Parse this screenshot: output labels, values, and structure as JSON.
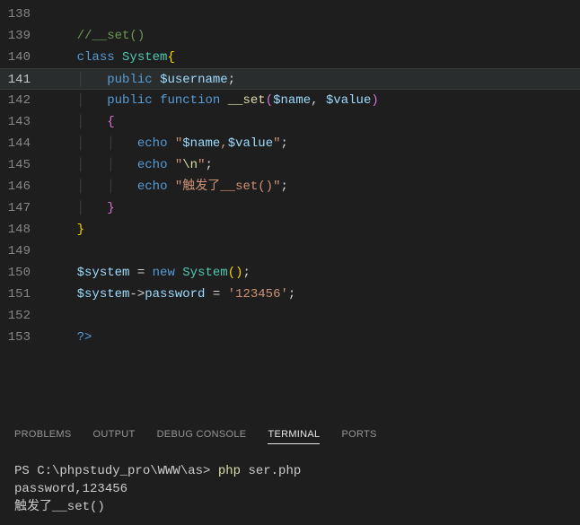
{
  "editor": {
    "lines": [
      {
        "num": "138",
        "html": ""
      },
      {
        "num": "139",
        "html": "<span class='c-comment'>//__set()</span>"
      },
      {
        "num": "140",
        "html": "<span class='c-keyword'>class</span> <span class='c-type'>System</span><span class='c-paren'>{</span>"
      },
      {
        "num": "141",
        "active": true,
        "html": "<span class='indent-guide'>│</span>   <span class='c-keyword'>public</span> <span class='c-var'>$username</span><span class='c-punct'>;</span>"
      },
      {
        "num": "142",
        "html": "<span class='indent-guide'>│</span>   <span class='c-keyword'>public</span> <span class='c-keyword'>function</span> <span class='c-func'>__set</span><span class='c-paren-pink'>(</span><span class='c-var'>$name</span><span class='c-punct'>,</span> <span class='c-var'>$value</span><span class='c-paren-pink'>)</span>"
      },
      {
        "num": "143",
        "html": "<span class='indent-guide'>│</span>   <span class='c-paren-pink'>{</span>"
      },
      {
        "num": "144",
        "html": "<span class='indent-guide'>│</span>   <span class='indent-guide'>│</span>   <span class='c-keyword'>echo</span> <span class='c-string'>\"</span><span class='c-var'>$name</span><span class='c-string'>,</span><span class='c-var'>$value</span><span class='c-string'>\"</span><span class='c-punct'>;</span>"
      },
      {
        "num": "145",
        "html": "<span class='indent-guide'>│</span>   <span class='indent-guide'>│</span>   <span class='c-keyword'>echo</span> <span class='c-string'>\"</span><span class='c-func'>\\n</span><span class='c-string'>\"</span><span class='c-punct'>;</span>"
      },
      {
        "num": "146",
        "html": "<span class='indent-guide'>│</span>   <span class='indent-guide'>│</span>   <span class='c-keyword'>echo</span> <span class='c-string'>\"触发了__set()\"</span><span class='c-punct'>;</span>"
      },
      {
        "num": "147",
        "html": "<span class='indent-guide'>│</span>   <span class='c-paren-pink'>}</span>"
      },
      {
        "num": "148",
        "html": "<span class='c-paren'>}</span>"
      },
      {
        "num": "149",
        "html": ""
      },
      {
        "num": "150",
        "html": "<span class='c-var'>$system</span> <span class='c-op'>=</span> <span class='c-keyword'>new</span> <span class='c-type'>System</span><span class='c-paren'>()</span><span class='c-punct'>;</span>"
      },
      {
        "num": "151",
        "html": "<span class='c-var'>$system</span><span class='c-op'>-></span><span class='c-var'>password</span> <span class='c-op'>=</span> <span class='c-string'>'123456'</span><span class='c-punct'>;</span>"
      },
      {
        "num": "152",
        "html": ""
      },
      {
        "num": "153",
        "html": "<span class='c-php'>?></span>"
      }
    ]
  },
  "panel": {
    "tabs": {
      "problems": "PROBLEMS",
      "output": "OUTPUT",
      "debug": "DEBUG CONSOLE",
      "terminal": "TERMINAL",
      "ports": "PORTS"
    }
  },
  "terminal": {
    "prompt": "PS C:\\phpstudy_pro\\WWW\\as> ",
    "cmd": "php ",
    "arg": "ser.php",
    "out1": "password,123456",
    "out2": "触发了__set()"
  }
}
